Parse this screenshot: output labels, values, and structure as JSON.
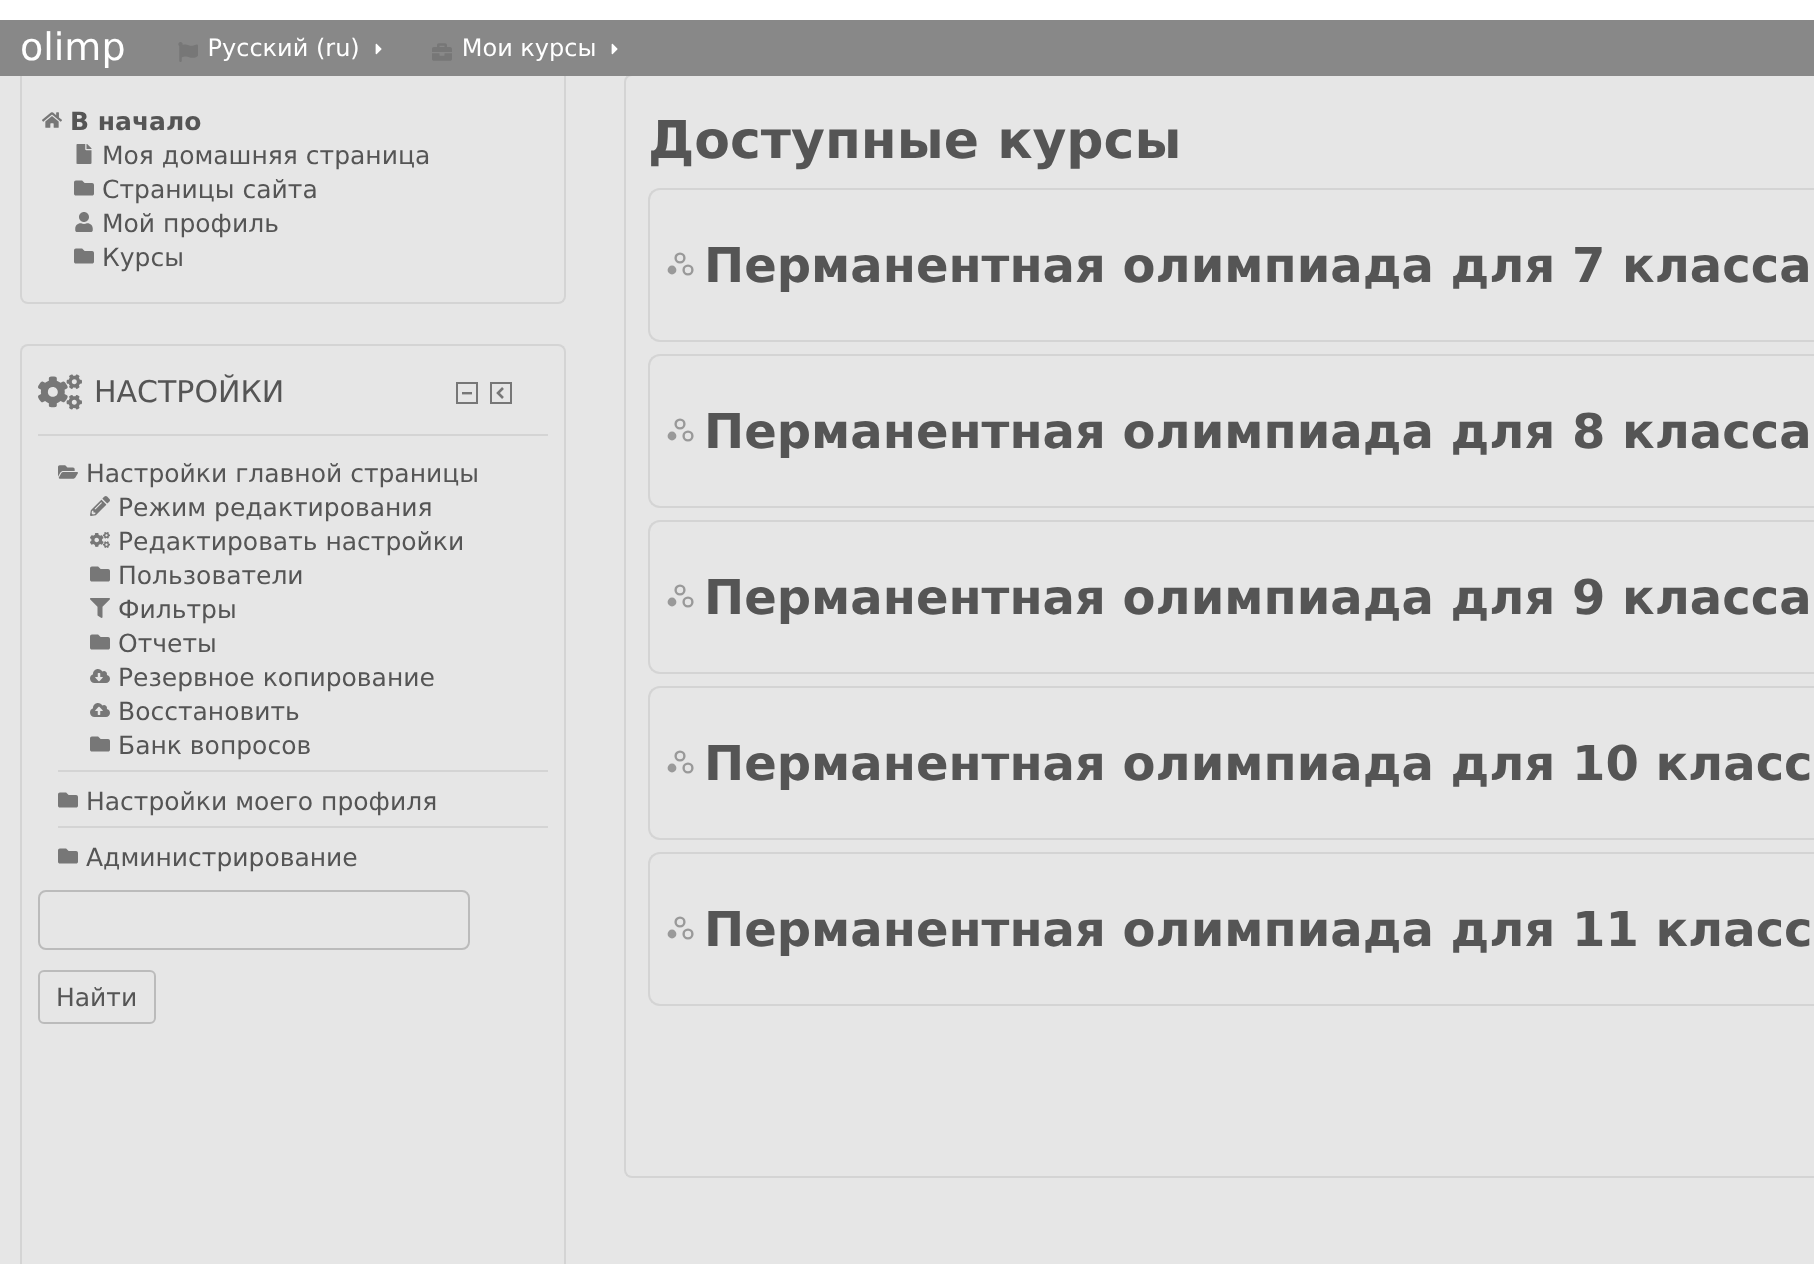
{
  "navbar": {
    "brand": "olimp",
    "menus": [
      {
        "kind": "flag",
        "label": "Русский (ru)"
      },
      {
        "kind": "briefcase",
        "label": "Мои курсы"
      }
    ]
  },
  "navigation": {
    "items": [
      {
        "kind": "home",
        "label": "В начало",
        "children": [
          {
            "kind": "page",
            "label": "Моя домашняя страница"
          },
          {
            "kind": "folder",
            "label": "Страницы сайта"
          },
          {
            "kind": "user",
            "label": "Мой профиль"
          },
          {
            "kind": "folder",
            "label": "Курсы"
          }
        ]
      }
    ]
  },
  "settings": {
    "title": "НАСТРОЙКИ",
    "items": [
      {
        "kind": "folder-open",
        "label": "Настройки главной страницы",
        "children": [
          {
            "kind": "pencil",
            "label": "Режим редактирования"
          },
          {
            "kind": "cogs",
            "label": "Редактировать настройки"
          },
          {
            "kind": "folder",
            "label": "Пользователи"
          },
          {
            "kind": "filter",
            "label": "Фильтры"
          },
          {
            "kind": "folder",
            "label": "Отчеты"
          },
          {
            "kind": "cloud-down",
            "label": "Резервное копирование"
          },
          {
            "kind": "cloud-up",
            "label": "Восстановить"
          },
          {
            "kind": "folder",
            "label": "Банк вопросов"
          }
        ]
      },
      {
        "kind": "folder",
        "label": "Настройки моего профиля"
      },
      {
        "kind": "folder",
        "label": "Администрирование"
      }
    ],
    "search": {
      "button": "Найти"
    }
  },
  "main": {
    "heading": "Доступные курсы",
    "courses": [
      {
        "title": "Перманентная олимпиада для 7 класса"
      },
      {
        "title": "Перманентная олимпиада для 8 класса"
      },
      {
        "title": "Перманентная олимпиада для 9 класса"
      },
      {
        "title": "Перманентная олимпиада для 10 класс"
      },
      {
        "title": "Перманентная олимпиада для 11 класс"
      }
    ]
  }
}
